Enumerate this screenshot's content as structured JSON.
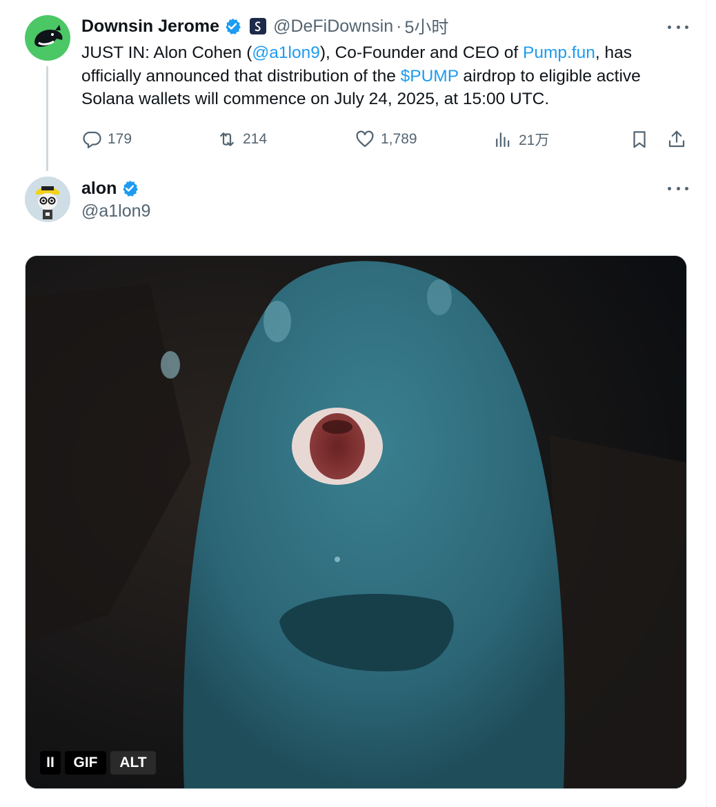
{
  "tweet1": {
    "author_name": "Downsin Jerome",
    "handle": "@DeFiDownsin",
    "separator": "·",
    "time": "5小时",
    "text": {
      "p1": "JUST IN: Alon Cohen (",
      "mention": "@a1lon9",
      "p2": "), Co-Founder and CEO of ",
      "link": "Pump.fun",
      "p3": ", has officially announced that distribution of the ",
      "cashtag": "$PUMP",
      "p4": " airdrop to eligible active Solana wallets will commence on July 24, 2025, at 15:00 UTC."
    },
    "actions": {
      "replies": "179",
      "reposts": "214",
      "likes": "1,789",
      "views": "21万"
    },
    "icons": [
      "reply-icon",
      "repost-icon",
      "like-icon",
      "views-icon",
      "bookmark-icon",
      "share-icon",
      "more-icon",
      "verified-icon",
      "org-badge-icon"
    ]
  },
  "tweet2": {
    "author_name": "alon",
    "handle": "@a1lon9",
    "media": {
      "controls": {
        "pause": "II",
        "gif": "GIF",
        "alt": "ALT"
      }
    }
  },
  "colors": {
    "text": "#0f1419",
    "secondary": "#536471",
    "link": "#1d9bf0",
    "verified": "#1d9bf0",
    "avatar1_bg": "#4cc766",
    "creature": "#2f6e7d"
  }
}
